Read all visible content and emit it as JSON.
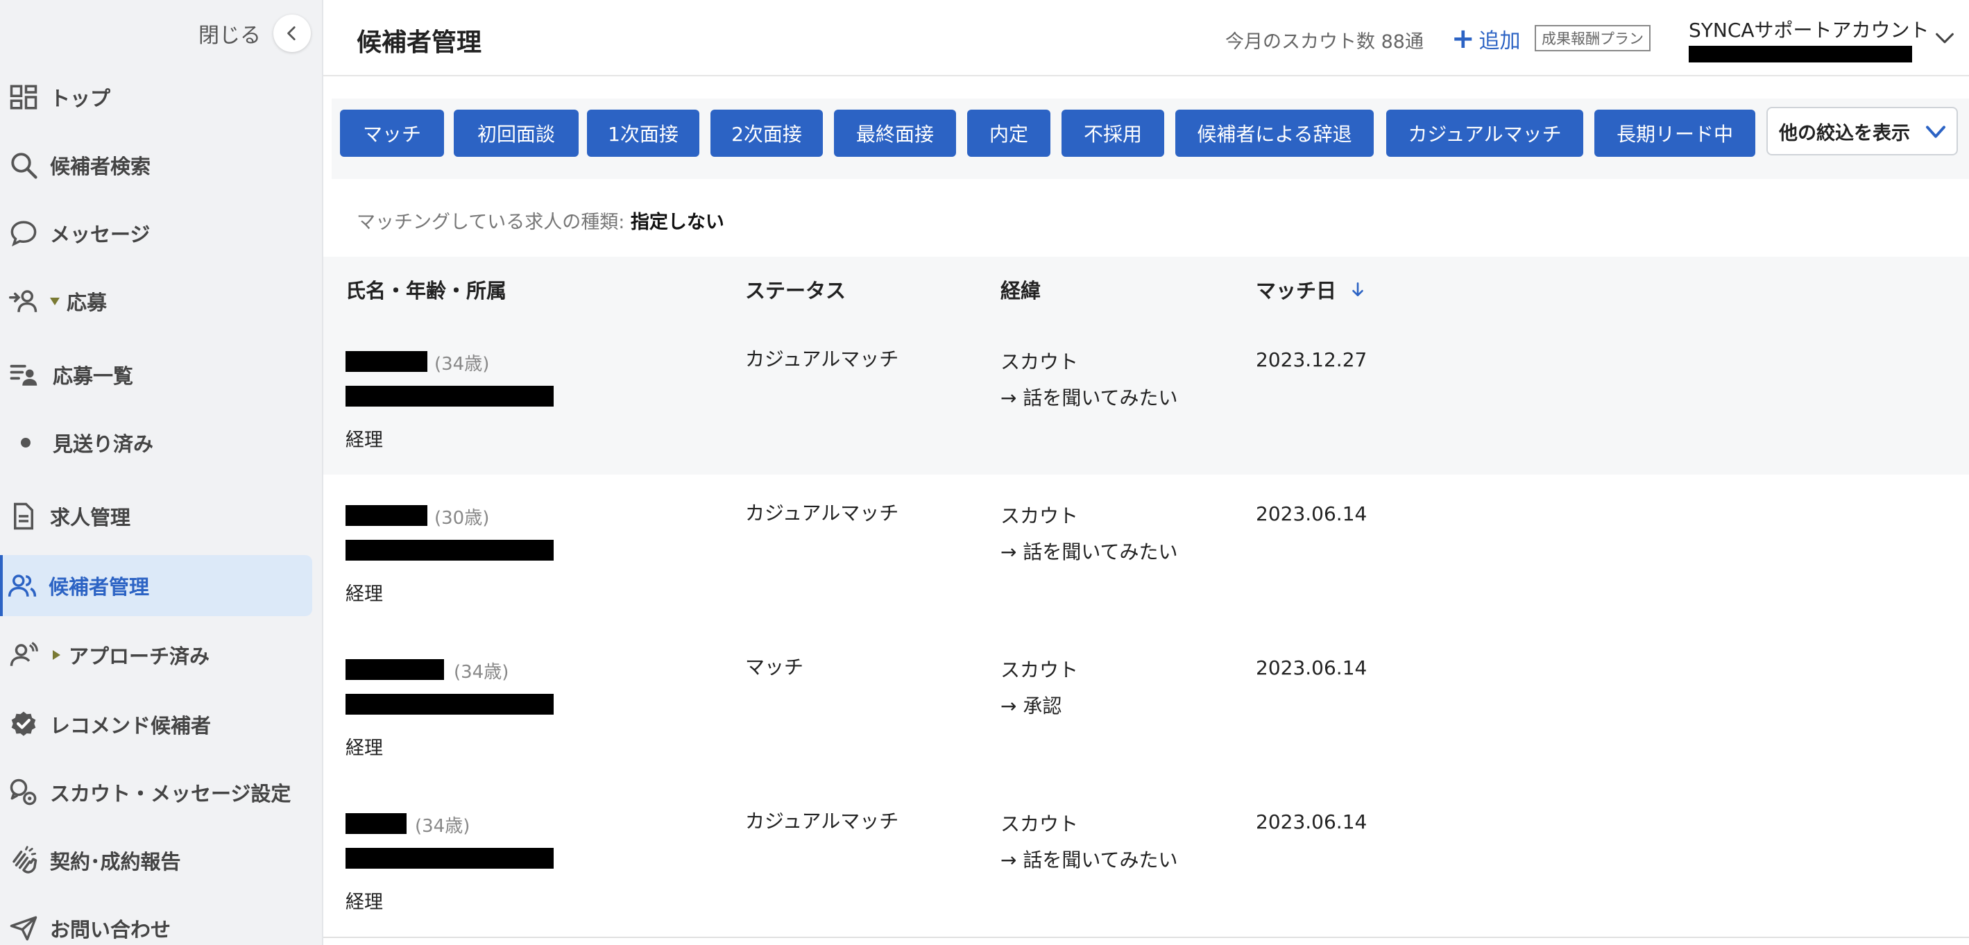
{
  "sidebar": {
    "close_label": "閉じる",
    "items": [
      {
        "label": "トップ",
        "icon": "grid-icon"
      },
      {
        "label": "候補者検索",
        "icon": "search-icon"
      },
      {
        "label": "メッセージ",
        "icon": "chat-bubble-icon"
      },
      {
        "label": "応募",
        "icon": "person-arrow-icon"
      },
      {
        "label": "応募一覧",
        "icon": "list-person-icon"
      },
      {
        "label": "見送り済み",
        "icon": "bullet-icon"
      },
      {
        "label": "求人管理",
        "icon": "document-icon"
      },
      {
        "label": "候補者管理",
        "icon": "people-icon",
        "active": true
      },
      {
        "label": "アプローチ済み",
        "icon": "person-wave-icon"
      },
      {
        "label": "レコメンド候補者",
        "icon": "verified-badge-icon"
      },
      {
        "label": "スカウト・メッセージ設定",
        "icon": "chat-gear-icon"
      },
      {
        "label": "契約･成約報告",
        "icon": "clap-hands-icon"
      },
      {
        "label": "お問い合わせ",
        "icon": "paper-plane-icon"
      }
    ]
  },
  "header": {
    "title": "候補者管理",
    "scout_count": "今月のスカウト数 88通",
    "add_label": "追加",
    "plan_badge": "成果報酬プラン",
    "account_name": "SYNCAサポートアカウント"
  },
  "filters": {
    "chips": [
      "マッチ",
      "初回面談",
      "1次面接",
      "2次面接",
      "最終面接",
      "内定",
      "不採用",
      "候補者による辞退",
      "カジュアルマッチ",
      "長期リード中"
    ],
    "more_label": "他の絞込を表示"
  },
  "jobtype": {
    "label": "マッチングしている求人の種類: ",
    "value": "指定しない"
  },
  "table": {
    "headers": {
      "name": "氏名・年齢・所属",
      "status": "ステータス",
      "route": "経緯",
      "date": "マッチ日"
    },
    "rows": [
      {
        "age": "(34歳)",
        "dept": "経理",
        "status": "カジュアルマッチ",
        "route": "スカウト",
        "route_detail": "→ 話を聞いてみたい",
        "date": "2023.12.27"
      },
      {
        "age": "(30歳)",
        "dept": "経理",
        "status": "カジュアルマッチ",
        "route": "スカウト",
        "route_detail": "→ 話を聞いてみたい",
        "date": "2023.06.14"
      },
      {
        "age": "(34歳)",
        "dept": "経理",
        "status": "マッチ",
        "route": "スカウト",
        "route_detail": "→ 承認",
        "date": "2023.06.14"
      },
      {
        "age": "(34歳)",
        "dept": "経理",
        "status": "カジュアルマッチ",
        "route": "スカウト",
        "route_detail": "→ 話を聞いてみたい",
        "date": "2023.06.14"
      }
    ]
  },
  "colors": {
    "accent": "#2c63c4",
    "sidebar_bg": "#f1f2f4",
    "active_bg": "#dce9f8"
  }
}
